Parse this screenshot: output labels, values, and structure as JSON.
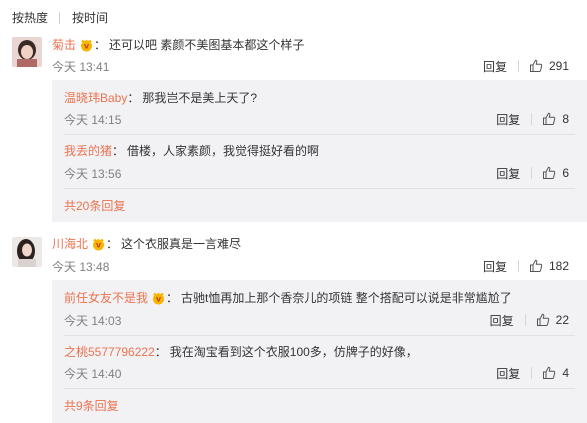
{
  "sort": {
    "hot": "按热度",
    "time": "按时间"
  },
  "colors": {
    "accent": "#eb7350",
    "subbg": "#f2f2f5"
  },
  "comments": [
    {
      "user": "菊击",
      "has_badge": true,
      "text": "还可以吧 素颜不美图基本都这个样子",
      "time": "今天 13:41",
      "reply": "回复",
      "likes": "291",
      "replies": [
        {
          "user": "温晓玮Baby",
          "text": "那我岂不是美上天了?",
          "time": "今天 14:15",
          "reply": "回复",
          "likes": "8"
        },
        {
          "user": "我丢的猪",
          "text": "借楼，人家素颜，我觉得挺好看的啊",
          "time": "今天 13:56",
          "reply": "回复",
          "likes": "6"
        }
      ],
      "more": "共20条回复"
    },
    {
      "user": "川海北",
      "has_badge": true,
      "text": "这个衣服真是一言难尽",
      "time": "今天 13:48",
      "reply": "回复",
      "likes": "182",
      "replies": [
        {
          "user": "前任女友不是我",
          "has_badge": true,
          "text": "古驰t恤再加上那个香奈儿的项链 整个搭配可以说是非常尴尬了",
          "time": "今天 14:03",
          "reply": "回复",
          "likes": "22"
        },
        {
          "user": "之桃5577796222",
          "text": "我在淘宝看到这个衣服100多，仿牌子的好像，",
          "time": "今天 14:40",
          "reply": "回复",
          "likes": "4"
        }
      ],
      "more": "共9条回复"
    }
  ]
}
